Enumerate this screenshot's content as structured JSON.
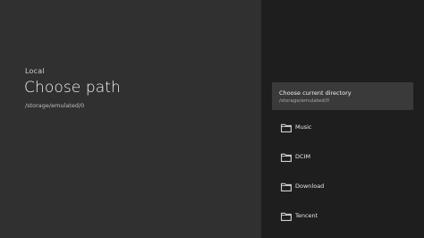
{
  "header": {
    "breadcrumb": "Local",
    "title": "Choose path",
    "subtitle": "/storage/emulated/0"
  },
  "current_directory": {
    "title": "Choose current directory",
    "path": "/storage/emulated/0"
  },
  "folders": [
    {
      "label": "Music",
      "icon": "folder-icon"
    },
    {
      "label": "DCIM",
      "icon": "folder-icon"
    },
    {
      "label": "Download",
      "icon": "folder-icon"
    },
    {
      "label": "Tencent",
      "icon": "folder-icon"
    }
  ],
  "colors": {
    "left_background": "#303030",
    "right_background": "#1e1e1e",
    "selected_item_background": "#3a3a3a",
    "icon_color": "#e6e6e6"
  }
}
